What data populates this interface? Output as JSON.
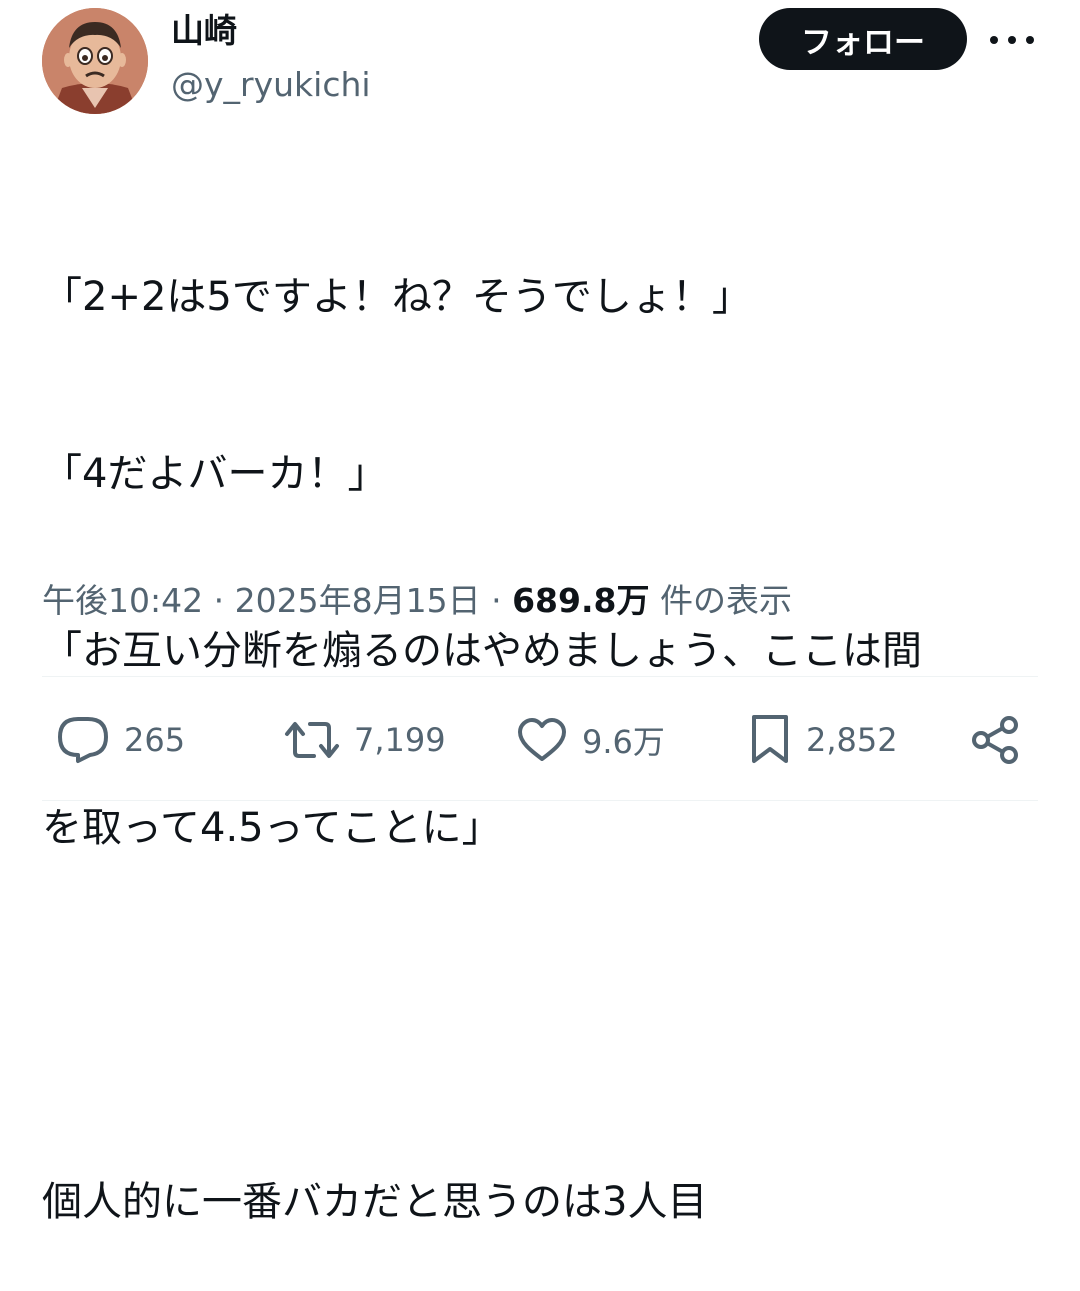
{
  "user": {
    "display_name": "山崎",
    "handle": "@y_ryukichi",
    "avatar_icon": "cartoon-face-avatar"
  },
  "header": {
    "follow_label": "フォロー",
    "more_icon": "more-horizontal-icon"
  },
  "tweet": {
    "lines": [
      "「2+2は5ですよ！ね？そうでしょ！」",
      "「4だよバーカ！」",
      "「お互い分断を煽るのはやめましょう、ここは間",
      "を取って4.5ってことに」",
      "個人的に一番バカだと思うのは3人目"
    ]
  },
  "meta": {
    "time": "午後10:42",
    "separator": " · ",
    "date": "2025年8月15日",
    "views_count": "689.8万",
    "views_label": " 件の表示"
  },
  "actions": {
    "reply": {
      "icon": "reply-icon",
      "count": "265"
    },
    "retweet": {
      "icon": "retweet-icon",
      "count": "7,199"
    },
    "like": {
      "icon": "heart-icon",
      "count": "9.6万"
    },
    "bookmark": {
      "icon": "bookmark-icon",
      "count": "2,852"
    },
    "share": {
      "icon": "share-icon"
    }
  },
  "colors": {
    "text_primary": "#0f1419",
    "text_secondary": "#536471",
    "button_bg": "#0f1419",
    "divider": "#eff3f4"
  }
}
